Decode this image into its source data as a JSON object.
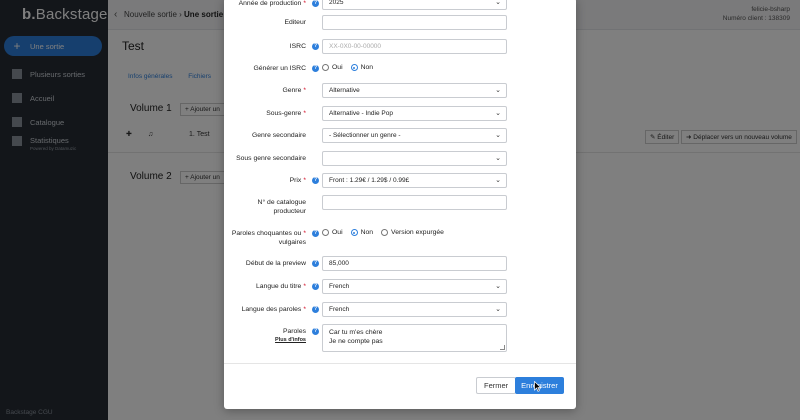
{
  "app": {
    "logo": "Backstage",
    "logo_mark": "b.",
    "breadcrumb": {
      "parent": "Nouvelle sortie",
      "current": "Une sortie"
    },
    "user": {
      "name": "felicie-bsharp",
      "client": "Numéro client : 138309"
    },
    "nav": [
      {
        "label": "Une sortie",
        "icon": "plus-icon"
      },
      {
        "label": "Plusieurs sorties",
        "icon": "stack-icon"
      },
      {
        "label": "Accueil",
        "icon": "grid-icon"
      },
      {
        "label": "Catalogue",
        "icon": "catalog-icon"
      },
      {
        "label": "Statistiques",
        "sub": "Powered by Datamuzic",
        "icon": "stats-icon"
      }
    ],
    "footer": "Backstage CGU",
    "page_title": "Test",
    "tabs": [
      "Infos générales",
      "Fichiers"
    ],
    "volume1": "Volume 1",
    "volume2": "Volume 2",
    "add_button": "Ajouter un",
    "track": "1. Test",
    "edit_button": "Éditer",
    "move_button": "Déplacer vers un nouveau volume"
  },
  "form": {
    "annee": {
      "label": "Année de production",
      "value": "2025"
    },
    "editeur": {
      "label": "Editeur",
      "value": ""
    },
    "isrc": {
      "label": "ISRC",
      "placeholder": "XX-0X0-00-00000"
    },
    "generer_isrc": {
      "label": "Générer un ISRC",
      "yes": "Oui",
      "no": "Non",
      "selected": "no"
    },
    "genre": {
      "label": "Genre",
      "value": "Alternative"
    },
    "sous_genre": {
      "label": "Sous-genre",
      "value": "Alternative - Indie Pop"
    },
    "genre_secondaire": {
      "label": "Genre secondaire",
      "value": "- Sélectionner un genre -"
    },
    "sous_genre_secondaire": {
      "label": "Sous genre secondaire",
      "value": ""
    },
    "prix": {
      "label": "Prix",
      "value": "Front : 1.29€ / 1.29$ / 0.99£"
    },
    "catalogue": {
      "label_line1": "N° de catalogue",
      "label_line2": "producteur",
      "value": ""
    },
    "paroles_choquantes": {
      "label_line1": "Paroles choquantes ou",
      "label_line2": "vulgaires",
      "yes": "Oui",
      "no": "Non",
      "expurgee": "Version expurgée",
      "selected": "no"
    },
    "debut_preview": {
      "label": "Début de la preview",
      "value": "85,000"
    },
    "langue_titre": {
      "label": "Langue du titre",
      "value": "French"
    },
    "langue_paroles": {
      "label": "Langue des paroles",
      "value": "French"
    },
    "paroles": {
      "label": "Paroles",
      "link": "Plus d'infos",
      "value": "Car tu m'es chère\nJe ne compte pas"
    }
  },
  "footer_buttons": {
    "close": "Fermer",
    "save": "Enregistrer"
  },
  "colors": {
    "accent": "#2d7fdc",
    "required": "#d0021b",
    "sidebar": "#262c35"
  }
}
